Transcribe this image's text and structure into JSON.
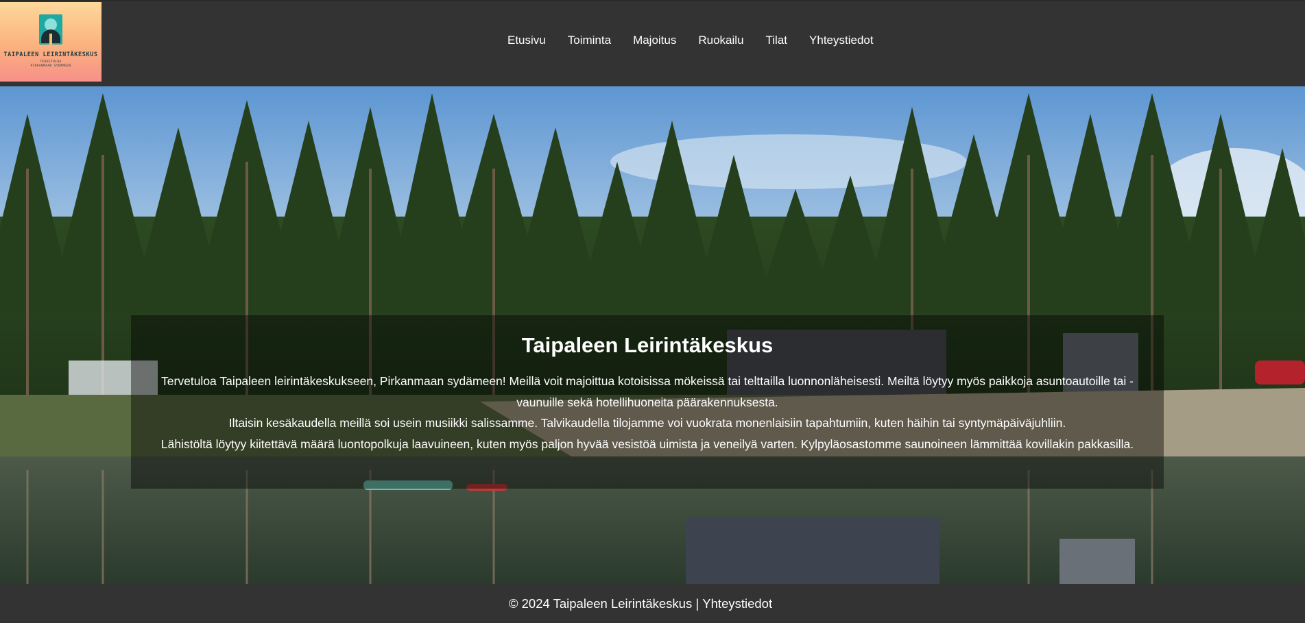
{
  "logo": {
    "name": "TAIPALEEN LEIRINTÄKESKUS",
    "sub1": "TERVETULOA",
    "sub2": "PIRKANMAAN SYDÄMEEN"
  },
  "nav": {
    "items": [
      "Etusivu",
      "Toiminta",
      "Majoitus",
      "Ruokailu",
      "Tilat",
      "Yhteystiedot"
    ]
  },
  "hero": {
    "title": "Taipaleen Leirintäkeskus",
    "paragraph1": "Tervetuloa Taipaleen leirintäkeskukseen, Pirkanmaan sydämeen! Meillä voit majoittua kotoisissa mökeissä tai telttailla luonnonläheisesti. Meiltä löytyy myös paikkoja asuntoautoille tai -vaunuille sekä hotellihuoneita päärakennuksesta.",
    "paragraph2": "Iltaisin kesäkaudella meillä soi usein musiikki salissamme. Talvikaudella tilojamme voi vuokrata monenlaisiin tapahtumiin, kuten häihin tai syntymäpäiväjuhliin.",
    "paragraph3": "Lähistöltä löytyy kiitettävä määrä luontopolkuja laavuineen, kuten myös paljon hyvää vesistöä uimista ja veneilyä varten. Kylpyläosastomme saunoineen lämmittää kovillakin pakkasilla."
  },
  "footer": {
    "copyright": "© 2024 Taipaleen Leirintäkeskus | ",
    "link": "Yhteystiedot"
  }
}
